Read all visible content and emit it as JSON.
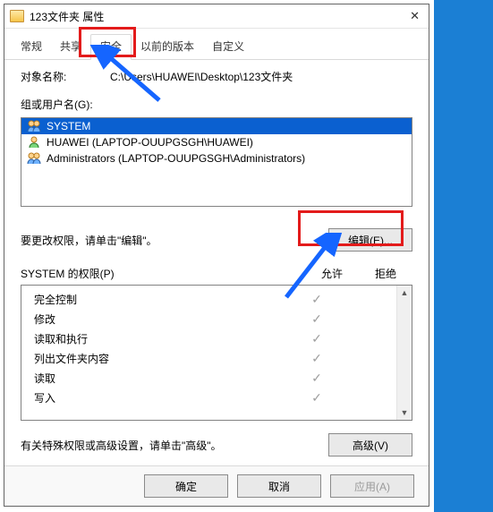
{
  "window": {
    "title": "123文件夹 属性"
  },
  "tabs": {
    "t0": "常规",
    "t1": "共享",
    "t2": "安全",
    "t3": "以前的版本",
    "t4": "自定义"
  },
  "object": {
    "label": "对象名称:",
    "path": "C:\\Users\\HUAWEI\\Desktop\\123文件夹"
  },
  "groups": {
    "label": "组或用户名(G):",
    "items": [
      {
        "name": "SYSTEM",
        "selected": true
      },
      {
        "name": "HUAWEI (LAPTOP-OUUPGSGH\\HUAWEI)",
        "selected": false
      },
      {
        "name": "Administrators (LAPTOP-OUUPGSGH\\Administrators)",
        "selected": false
      }
    ]
  },
  "edit": {
    "hint": "要更改权限，请单击\"编辑\"。",
    "button": "编辑(E)..."
  },
  "perm": {
    "header": "SYSTEM 的权限(P)",
    "allow": "允许",
    "deny": "拒绝",
    "rows": [
      {
        "name": "完全控制",
        "allow": true,
        "deny": false
      },
      {
        "name": "修改",
        "allow": true,
        "deny": false
      },
      {
        "name": "读取和执行",
        "allow": true,
        "deny": false
      },
      {
        "name": "列出文件夹内容",
        "allow": true,
        "deny": false
      },
      {
        "name": "读取",
        "allow": true,
        "deny": false
      },
      {
        "name": "写入",
        "allow": true,
        "deny": false
      }
    ]
  },
  "advanced": {
    "hint": "有关特殊权限或高级设置，请单击\"高级\"。",
    "button": "高级(V)"
  },
  "footer": {
    "ok": "确定",
    "cancel": "取消",
    "apply": "应用(A)"
  }
}
